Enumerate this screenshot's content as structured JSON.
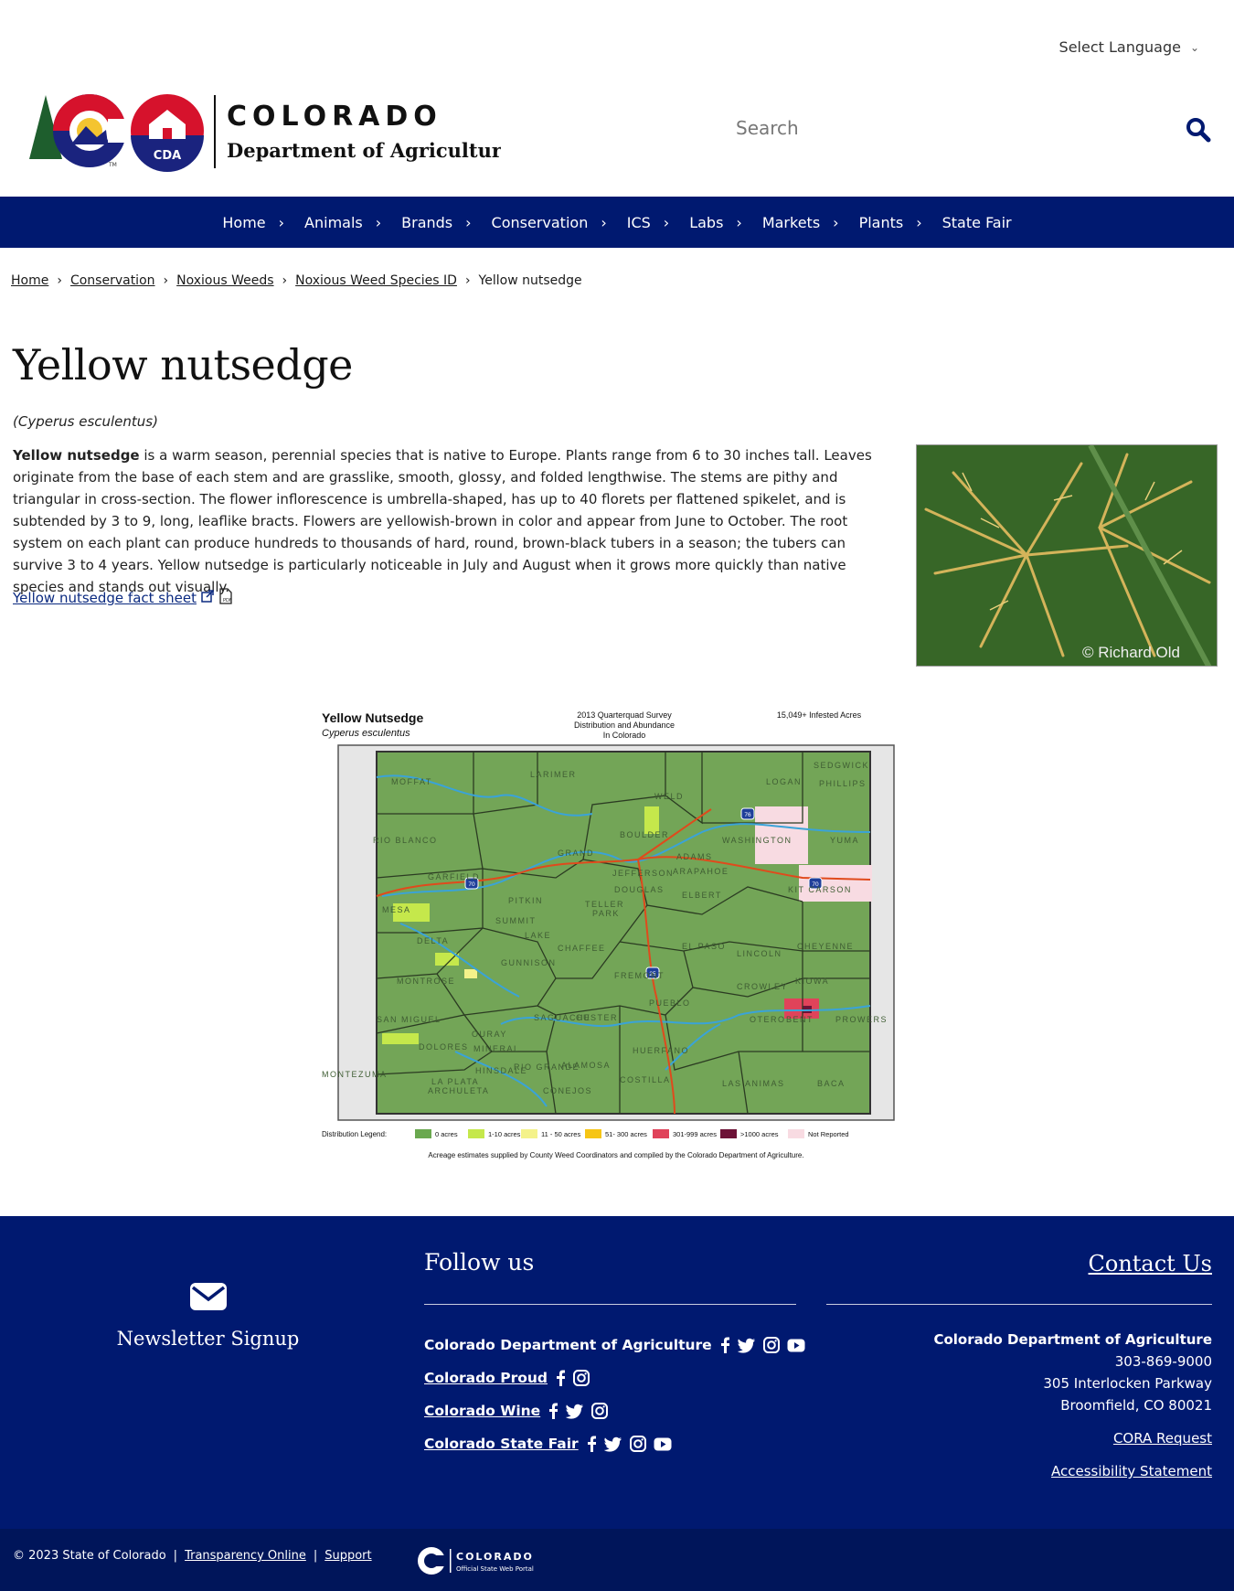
{
  "language": {
    "label": "Select Language"
  },
  "brand": {
    "state": "COLORADO",
    "department": "Department of Agriculture",
    "badge": "CDA",
    "tm": "TM"
  },
  "search": {
    "placeholder": "Search"
  },
  "nav": [
    {
      "label": "Home"
    },
    {
      "label": "Animals"
    },
    {
      "label": "Brands"
    },
    {
      "label": "Conservation"
    },
    {
      "label": "ICS"
    },
    {
      "label": "Labs"
    },
    {
      "label": "Markets"
    },
    {
      "label": "Plants"
    },
    {
      "label": "State Fair"
    }
  ],
  "breadcrumb": {
    "home": "Home",
    "conservation": "Conservation",
    "weeds": "Noxious Weeds",
    "species": "Noxious Weed Species ID",
    "current": "Yellow nutsedge"
  },
  "page": {
    "title": "Yellow nutsedge",
    "scientific": "(Cyperus esculentus)",
    "lead": "Yellow nutsedge",
    "body": " is a warm season, perennial species that is native to Europe. Plants range from 6 to 30 inches tall. Leaves originate from the base of each stem and are grasslike, smooth, glossy, and folded lengthwise. The stems are pithy and triangular in cross-section. The flower inflorescence is umbrella-shaped, has up to 40 florets per flattened spikelet, and is subtended by 3 to 9, long, leaflike bracts. Flowers are yellowish-brown in color and appear from June to October. The root system on each plant can produce hundreds to thousands of hard, round, brown-black tubers in a season; the tubers can survive 3 to 4 years. Yellow nutsedge is particularly noticeable in July and August when it grows more quickly than native species and stands out visually.",
    "fact_link": "Yellow nutsedge fact sheet",
    "photo_credit": "© Richard Old"
  },
  "map": {
    "title": "Yellow Nutsedge",
    "subtitle": "Cyperus esculentus",
    "survey1": "2013 Quarterquad Survey",
    "survey2": "Distribution and Abundance",
    "survey3": "In Colorado",
    "acres": "15,049+ Infested Acres",
    "legend_label": "Distribution Legend:",
    "legend": [
      {
        "label": "0 acres",
        "color": "#6aa84f"
      },
      {
        "label": "1-10 acres",
        "color": "#c5e84b"
      },
      {
        "label": "11 - 50 acres",
        "color": "#f4f28a"
      },
      {
        "label": "51- 300 acres",
        "color": "#f6c515"
      },
      {
        "label": "301-999 acres",
        "color": "#e0435a"
      },
      {
        "label": ">1000 acres",
        "color": "#6d1237"
      },
      {
        "label": "Not Reported",
        "color": "#f8dbe2"
      }
    ],
    "footnote": "Acreage estimates supplied by County Weed Coordinators and compiled by the Colorado Department of Agriculture.",
    "counties": [
      "MOFFAT",
      "LARIMER",
      "WELD",
      "LOGAN",
      "SEDGWICK",
      "PHILLIPS",
      "RIO BLANCO",
      "GRAND",
      "BOULDER",
      "WASHINGTON",
      "YUMA",
      "GARFIELD",
      "ADAMS",
      "ARAPAHOE",
      "ELBERT",
      "KIT CARSON",
      "MESA",
      "PITKIN",
      "PARK",
      "DOUGLAS",
      "DELTA",
      "GUNNISON",
      "CHAFFEE",
      "EL PASO",
      "LINCOLN",
      "CHEYENNE",
      "MONTROSE",
      "FREMONT",
      "CROWLEY",
      "KIOWA",
      "SAN MIGUEL",
      "SAGUACHE",
      "CUSTER",
      "PUEBLO",
      "OTERO",
      "BENT",
      "PROWERS",
      "MONTEZUMA",
      "MINERAL",
      "RIO GRANDE",
      "ALAMOSA",
      "HUERFANO",
      "LAS ANIMAS",
      "BACA",
      "ARCHULETA",
      "CONEJOS",
      "COSTILLA",
      "SUMMIT",
      "JEFFERSON",
      "LA PLATA",
      "DOLORES",
      "OURAY",
      "HINSDALE",
      "LAKE",
      "TELLER"
    ],
    "interstates": [
      "76",
      "70",
      "70",
      "25"
    ]
  },
  "footer": {
    "newsletter": "Newsletter Signup",
    "follow": "Follow us",
    "social": [
      {
        "name": "Colorado Department of Agriculture",
        "icons": [
          "facebook-icon",
          "twitter-icon",
          "instagram-icon",
          "youtube-icon"
        ],
        "underline": false
      },
      {
        "name": "Colorado Proud",
        "icons": [
          "facebook-icon",
          "instagram-icon"
        ],
        "underline": true
      },
      {
        "name": "Colorado Wine",
        "icons": [
          "facebook-icon",
          "twitter-icon",
          "instagram-icon"
        ],
        "underline": true
      },
      {
        "name": "Colorado State Fair",
        "icons": [
          "facebook-icon",
          "twitter-icon",
          "instagram-icon",
          "youtube-icon"
        ],
        "underline": true
      }
    ],
    "contact_title": "Contact Us",
    "org": "Colorado Department of Agriculture",
    "phone": "303-869-9000",
    "addr1": "305 Interlocken Parkway",
    "addr2": "Broomfield, CO 80021",
    "cora": "CORA Request",
    "access": "Accessibility Statement"
  },
  "bottom": {
    "copyright": "© 2023 State of Colorado",
    "pipe": "|",
    "transparency": "Transparency Online",
    "support": "Support",
    "portal_name": "COLORADO",
    "portal_tag": "Official State Web Portal"
  },
  "colors": {
    "navy": "#001970",
    "map_green": "#6aa84f"
  }
}
